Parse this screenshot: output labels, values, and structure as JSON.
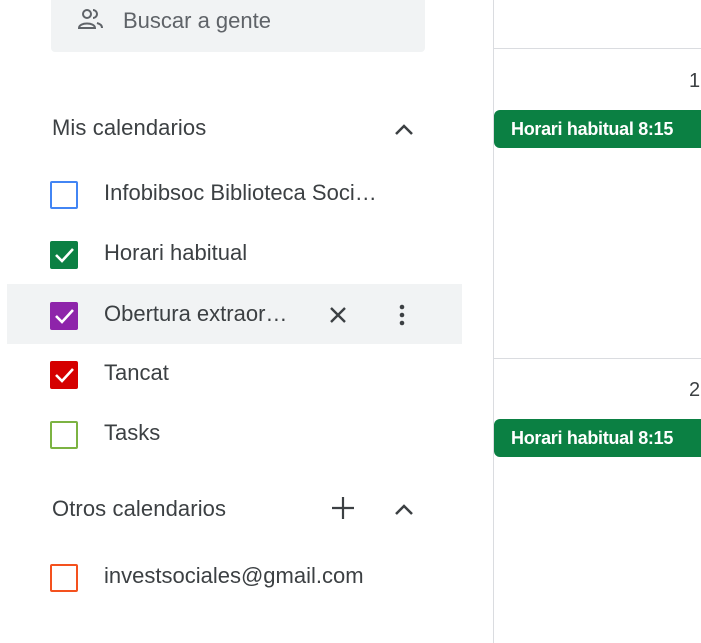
{
  "search": {
    "placeholder": "Buscar a gente"
  },
  "my_calendars": {
    "title": "Mis calendarios",
    "items": [
      {
        "label": "Infobibsoc Biblioteca Soci…",
        "checked": false,
        "color": "#4285f4"
      },
      {
        "label": "Horari habitual",
        "checked": true,
        "color": "#0b8043"
      },
      {
        "label": "Obertura extraor…",
        "checked": true,
        "color": "#8e24aa"
      },
      {
        "label": "Tancat",
        "checked": true,
        "color": "#d50000"
      },
      {
        "label": "Tasks",
        "checked": false,
        "color": "#7cb342"
      }
    ]
  },
  "other_calendars": {
    "title": "Otros calendarios",
    "items": [
      {
        "label": "investsociales@gmail.com",
        "checked": false,
        "color": "#f4511e"
      }
    ]
  },
  "calendar_grid": {
    "days": [
      {
        "number": "1",
        "event": "Horari habitual 8:15"
      },
      {
        "number": "2",
        "event": "Horari habitual 8:15"
      }
    ]
  }
}
